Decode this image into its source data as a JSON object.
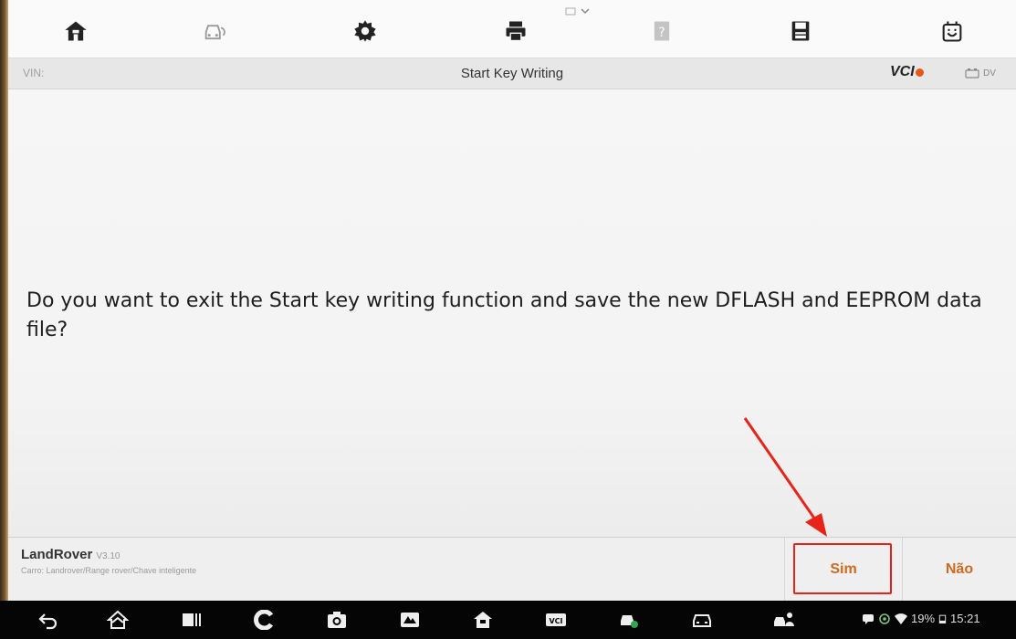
{
  "toolbar": {
    "icons": [
      "home-icon",
      "vehicle-swap-icon",
      "settings-icon",
      "print-icon",
      "help-icon",
      "save-icon",
      "feedback-icon"
    ]
  },
  "titlebar": {
    "vin_label": "VIN:",
    "title": "Start Key Writing",
    "vci_logo_text": "VCI",
    "battery_text": "DV"
  },
  "content": {
    "message": "Do you want to exit the Start key writing function and save the new DFLASH and EEPROM data file?"
  },
  "actionbar": {
    "make": "LandRover",
    "version": "V3.10",
    "vehicle_path": "Carro: Landrover/Range rover/Chave inteligente",
    "yes_label": "Sim",
    "no_label": "Não"
  },
  "statusbar": {
    "battery_percent": "19%",
    "time": "15:21"
  },
  "colors": {
    "accent": "#d2691e",
    "highlight": "#e8231a",
    "vci_dot": "#e8561a"
  }
}
